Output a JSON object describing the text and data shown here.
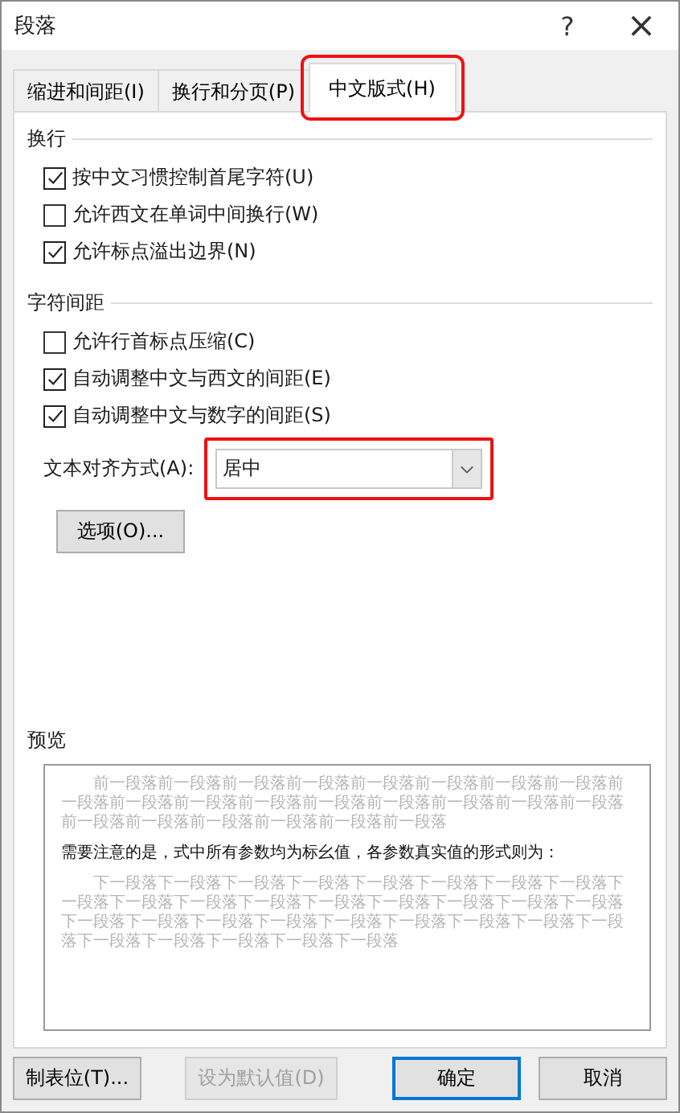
{
  "window": {
    "title": "段落",
    "help": "?",
    "close": "×"
  },
  "tabs": [
    {
      "label": "缩进和间距(I)",
      "selected": false,
      "highlighted": false
    },
    {
      "label": "换行和分页(P)",
      "selected": false,
      "highlighted": false
    },
    {
      "label": "中文版式(H)",
      "selected": true,
      "highlighted": true
    }
  ],
  "sections": [
    {
      "title": "换行",
      "options": [
        {
          "label": "按中文习惯控制首尾字符(U)",
          "checked": true
        },
        {
          "label": "允许西文在单词中间换行(W)",
          "checked": false
        },
        {
          "label": "允许标点溢出边界(N)",
          "checked": true
        }
      ]
    },
    {
      "title": "字符间距",
      "options": [
        {
          "label": "允许行首标点压缩(C)",
          "checked": false
        },
        {
          "label": "自动调整中文与西文的间距(E)",
          "checked": true
        },
        {
          "label": "自动调整中文与数字的间距(S)",
          "checked": true
        }
      ]
    }
  ],
  "alignment": {
    "label": "文本对齐方式(A):",
    "value": "居中",
    "highlighted": true
  },
  "options_button": "选项(O)...",
  "preview": {
    "title": "预览",
    "before": "前一段落前一段落前一段落前一段落前一段落前一段落前一段落前一段落前一段落前一段落前一段落前一段落前一段落前一段落前一段落前一段落前一段落前一段落前一段落前一段落前一段落前一段落前一段落",
    "sample": "需要注意的是，式中所有参数均为标幺值，各参数真实值的形式则为：",
    "after": "下一段落下一段落下一段落下一段落下一段落下一段落下一段落下一段落下一段落下一段落下一段落下一段落下一段落下一段落下一段落下一段落下一段落下一段落下一段落下一段落下一段落下一段落下一段落下一段落下一段落下一段落下一段落下一段落下一段落下一段落下一段落"
  },
  "buttons": [
    {
      "label": "制表位(T)...",
      "disabled": false,
      "default": false
    },
    {
      "label": "设为默认值(D)",
      "disabled": true,
      "default": false
    },
    {
      "label": "确定",
      "disabled": false,
      "default": true
    },
    {
      "label": "取消",
      "disabled": false,
      "default": false
    }
  ]
}
